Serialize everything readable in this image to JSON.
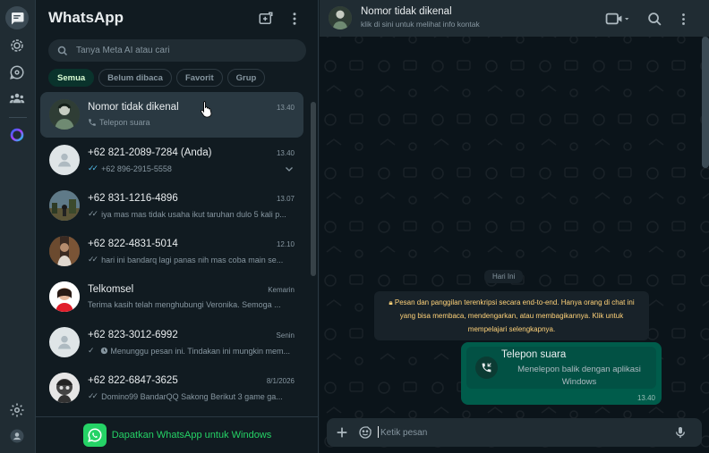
{
  "app": {
    "title": "WhatsApp"
  },
  "search": {
    "placeholder": "Tanya Meta AI atau cari"
  },
  "filters": [
    {
      "label": "Semua",
      "active": true
    },
    {
      "label": "Belum dibaca",
      "active": false
    },
    {
      "label": "Favorit",
      "active": false
    },
    {
      "label": "Grup",
      "active": false
    }
  ],
  "chats": [
    {
      "name": "Nomor tidak dikenal",
      "time": "13.40",
      "preview": "Telepon suara",
      "selected": true
    },
    {
      "name": "+62 821-2089-7284 (Anda)",
      "time": "13.40",
      "preview": "+62 896-2915-5558"
    },
    {
      "name": "+62 831-1216-4896",
      "time": "13.07",
      "preview": "iya mas mas tidak usaha ikut taruhan dulo 5 kali p..."
    },
    {
      "name": "+62 822-4831-5014",
      "time": "12.10",
      "preview": "hari ini  bandarq lagi panas nih mas coba main se..."
    },
    {
      "name": "Telkomsel",
      "time": "Kemarin",
      "preview": "Terima kasih telah menghubungi Veronika. Semoga ..."
    },
    {
      "name": "+62 823-3012-6992",
      "time": "Senin",
      "preview": "Menunggu pesan ini. Tindakan ini mungkin mem..."
    },
    {
      "name": "+62 822-6847-3625",
      "time": "8/1/2026",
      "preview": "Domino99  BandarQQ  Sakong Berikut 3 game ga..."
    }
  ],
  "get_app": {
    "label": "Dapatkan WhatsApp untuk Windows"
  },
  "conversation": {
    "name": "Nomor tidak dikenal",
    "subtitle": "klik di sini untuk melihat info kontak",
    "date_pill": "Hari Ini",
    "encryption_notice": "Pesan dan panggilan terenkripsi secara end-to-end. Hanya orang di chat ini yang bisa membaca, mendengarkan, atau membagikannya. Klik untuk mempelajari selengkapnya.",
    "call_message": {
      "title": "Telepon suara",
      "subtitle": "Menelepon balik dengan aplikasi Windows",
      "time": "13.40"
    }
  },
  "composer": {
    "placeholder": "Ketik pesan"
  },
  "colors": {
    "accent": "#25d366",
    "outgoing_bubble": "#005c4b",
    "notice_text": "#ffd279",
    "active_chip": "#0a332c"
  }
}
